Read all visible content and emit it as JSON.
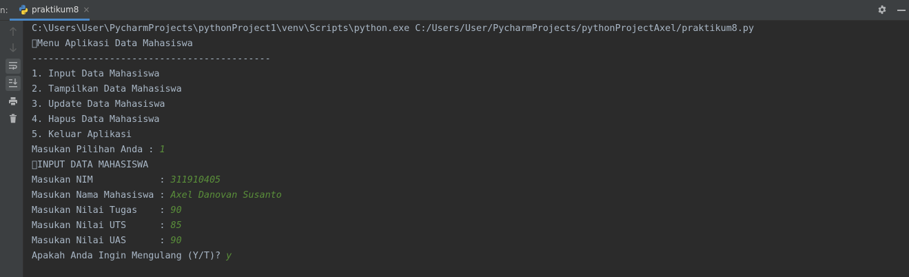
{
  "run_label": "n:",
  "tab": {
    "label": "praktikum8",
    "close": "×"
  },
  "console_lines": [
    {
      "text": "C:\\Users\\User\\PycharmProjects\\pythonProject1\\venv\\Scripts\\python.exe C:/Users/User/PycharmProjects/pythonProjectAxel/praktikum8.py",
      "input": ""
    },
    {
      "text": "\u0000Menu Aplikasi Data Mahasiswa",
      "input": ""
    },
    {
      "text": "-------------------------------------------",
      "input": ""
    },
    {
      "text": "1. Input Data Mahasiswa",
      "input": ""
    },
    {
      "text": "2. Tampilkan Data Mahasiswa",
      "input": ""
    },
    {
      "text": "3. Update Data Mahasiswa",
      "input": ""
    },
    {
      "text": "4. Hapus Data Mahasiswa",
      "input": ""
    },
    {
      "text": "5. Keluar Aplikasi",
      "input": ""
    },
    {
      "text": "Masukan Pilihan Anda : ",
      "input": "1"
    },
    {
      "text": "\u0000INPUT DATA MAHASISWA",
      "input": ""
    },
    {
      "text": "Masukan NIM            : ",
      "input": "311910405"
    },
    {
      "text": "Masukan Nama Mahasiswa : ",
      "input": "Axel Danovan Susanto"
    },
    {
      "text": "Masukan Nilai Tugas    : ",
      "input": "90"
    },
    {
      "text": "Masukan Nilai UTS      : ",
      "input": "85"
    },
    {
      "text": "Masukan Nilai UAS      : ",
      "input": "90"
    },
    {
      "text": "Apakah Anda Ingin Mengulang (Y/T)? ",
      "input": "y"
    }
  ],
  "colors": {
    "console_text": "#a9b7c6",
    "user_input": "#5a8f3a",
    "background": "#2b2b2b",
    "toolbar": "#3c3f41",
    "tab_underline": "#4a88c7"
  },
  "icons": {
    "tab": "python-file-icon",
    "settings": "gear-icon",
    "minimize": "minimize-icon",
    "toolbar": [
      "arrow-up-icon",
      "arrow-down-icon",
      "soft-wrap-icon",
      "scroll-to-end-icon",
      "print-icon",
      "trash-icon"
    ]
  }
}
